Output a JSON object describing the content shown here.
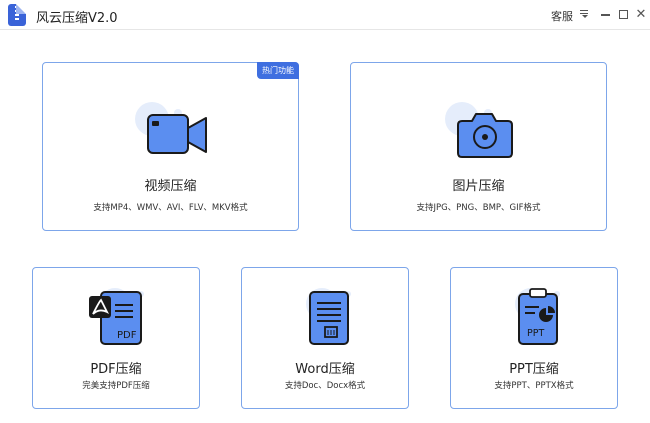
{
  "app": {
    "title": "风云压缩V2.0"
  },
  "titlebar": {
    "service_label": "客服",
    "menu_icon": "menu-icon",
    "minimize_icon": "minimize-icon",
    "maximize_icon": "maximize-icon",
    "close_icon": "close-icon",
    "close_glyph": "✕"
  },
  "colors": {
    "accent": "#3f6fe0",
    "card_border": "#7da6ea",
    "icon_fill": "#5b8ef0",
    "icon_halo": "#e5edfb"
  },
  "cards": {
    "video": {
      "title": "视频压缩",
      "desc": "支持MP4、WMV、AVI、FLV、MKV格式",
      "badge": "热门功能",
      "icon": "video-camera-icon"
    },
    "image": {
      "title": "图片压缩",
      "desc": "支持JPG、PNG、BMP、GIF格式",
      "icon": "photo-camera-icon"
    },
    "pdf": {
      "title": "PDF压缩",
      "desc": "完美支持PDF压缩",
      "icon": "pdf-file-icon",
      "icon_text": "PDF"
    },
    "word": {
      "title": "Word压缩",
      "desc": "支持Doc、Docx格式",
      "icon": "word-file-icon"
    },
    "ppt": {
      "title": "PPT压缩",
      "desc": "支持PPT、PPTX格式",
      "icon": "ppt-file-icon",
      "icon_text": "PPT"
    }
  }
}
